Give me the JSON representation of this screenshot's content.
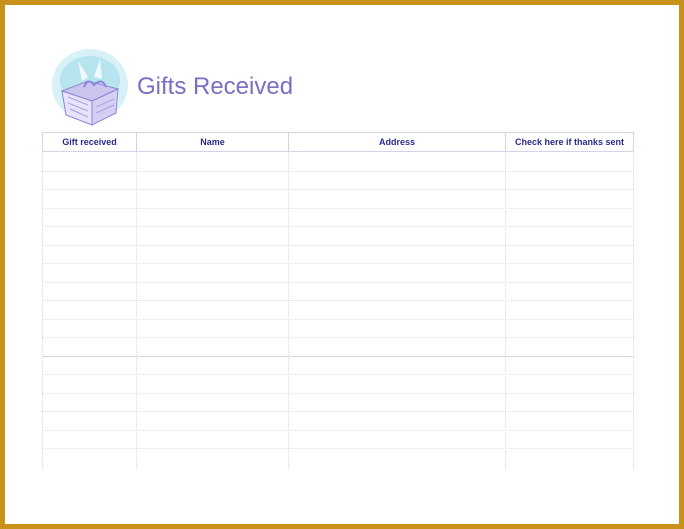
{
  "title": "Gifts Received",
  "logo": {
    "icon": "gift-box-icon"
  },
  "table": {
    "columns": [
      "Gift received",
      "Name",
      "Address",
      "Check here if thanks sent"
    ],
    "row_count": 16
  },
  "colors": {
    "frame": "#c8921a",
    "title": "#7b6dc6",
    "header_text": "#2b2a8c"
  }
}
